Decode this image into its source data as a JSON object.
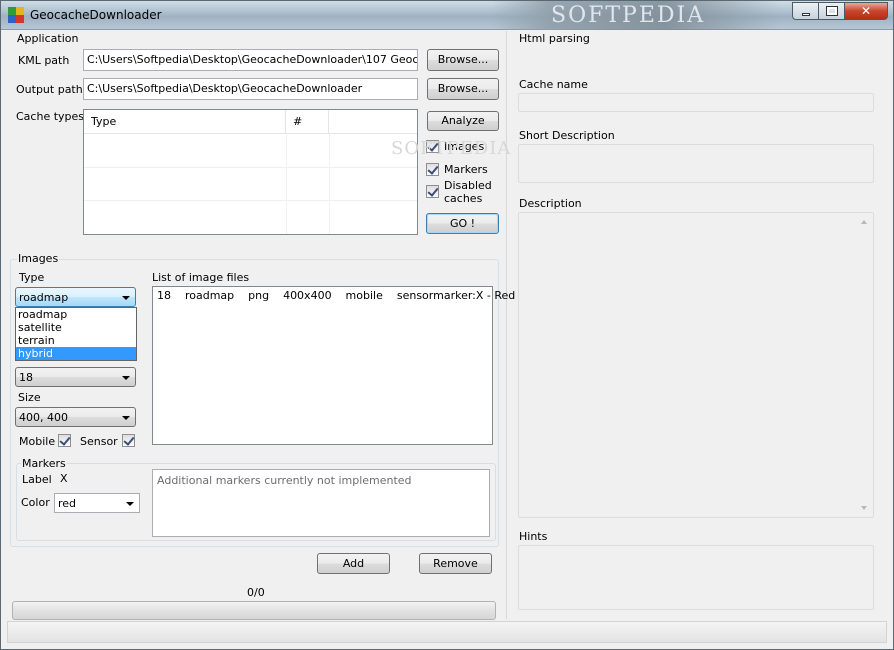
{
  "window": {
    "title": "GeocacheDownloader",
    "watermark": "SOFTPEDIA",
    "center_watermark": "SOFTPEDIA"
  },
  "application": {
    "group_title": "Application",
    "kml_label": "KML path",
    "kml_value": "C:\\Users\\Softpedia\\Desktop\\GeocacheDownloader\\107 Geocaches",
    "output_label": "Output path",
    "output_value": "C:\\Users\\Softpedia\\Desktop\\GeocacheDownloader",
    "browse_label": "Browse...",
    "cache_types_label": "Cache types",
    "columns": [
      "Type",
      "#"
    ],
    "analyze_label": "Analyze",
    "images_check": "Images",
    "markers_check": "Markers",
    "disabled_line1": "Disabled",
    "disabled_line2": "caches",
    "go_label": "GO !"
  },
  "images": {
    "group_title": "Images",
    "type_label": "Type",
    "type_selected": "roadmap",
    "type_options": [
      "roadmap",
      "satellite",
      "terrain",
      "hybrid"
    ],
    "type_highlighted": "hybrid",
    "zoom_value": "18",
    "size_label": "Size",
    "size_value": "400, 400",
    "mobile_label": "Mobile",
    "sensor_label": "Sensor",
    "list_label": "List of image files",
    "list_items": [
      "18    roadmap    png    400x400    mobile    sensormarker:X - Red"
    ]
  },
  "markers": {
    "group_title": "Markers",
    "label_label": "Label",
    "label_value": "X",
    "color_label": "Color",
    "color_value": "red",
    "note": "Additional markers currently not implemented"
  },
  "actions": {
    "add_label": "Add",
    "remove_label": "Remove",
    "progress_text": "0/0"
  },
  "html_parsing": {
    "group_title": "Html parsing",
    "cache_name_label": "Cache name",
    "short_desc_label": "Short Description",
    "desc_label": "Description",
    "hints_label": "Hints"
  }
}
